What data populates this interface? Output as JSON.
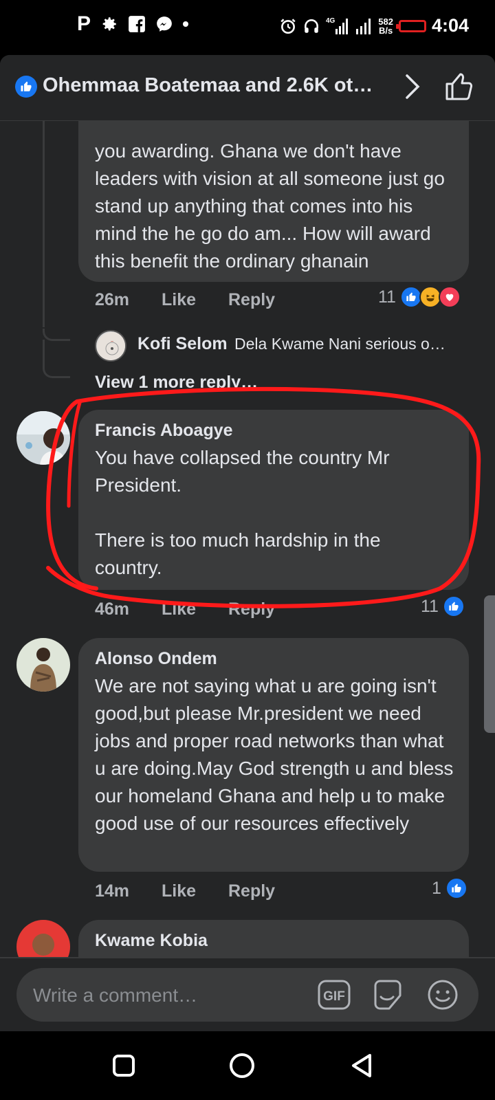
{
  "status_bar": {
    "time": "4:04",
    "net_speed_value": "582",
    "net_speed_unit": "B/s",
    "net_type": "4G",
    "left_icons": [
      "pinterest-icon",
      "settings-icon",
      "facebook-icon",
      "messenger-icon",
      "dot-icon"
    ],
    "right_icons": [
      "alarm-icon",
      "headphones-icon",
      "signal-icon",
      "signal-icon",
      "battery-icon"
    ]
  },
  "header": {
    "title": "Ohemmaa Boatemaa and 2.6K ot…"
  },
  "comments": [
    {
      "text": "you awarding. Ghana we don't have leaders with vision at all someone just go stand up anything that comes into his mind the he go do am... How will award this benefit the ordinary ghanain",
      "time": "26m",
      "like_label": "Like",
      "reply_label": "Reply",
      "reaction_count": "11",
      "reactions": [
        "like",
        "haha",
        "love"
      ]
    },
    {
      "name": "Francis Aboagye",
      "text_line1": "You have collapsed the country Mr President.",
      "text_line2": "There is too much hardship in the country.",
      "time": "46m",
      "like_label": "Like",
      "reply_label": "Reply",
      "reaction_count": "11",
      "reactions": [
        "like"
      ]
    },
    {
      "name": "Alonso Ondem",
      "text": "We are not saying what u are going isn't good,but please Mr.president we need jobs and proper road networks than what u are doing.May God strength u and bless our homeland Ghana and help u to make good use of our resources effectively",
      "time": "14m",
      "like_label": "Like",
      "reply_label": "Reply",
      "reaction_count": "1",
      "reactions": [
        "like"
      ]
    },
    {
      "name": "Kwame Kobia"
    }
  ],
  "reply_preview": {
    "name": "Kofi Selom",
    "text": "Dela Kwame Nani serious o…"
  },
  "view_more_replies": "View 1 more reply…",
  "composer": {
    "placeholder": "Write a comment…",
    "gif_label": "GIF"
  },
  "colors": {
    "background": "#242526",
    "bubble": "#3a3b3c",
    "like_blue": "#1877f2",
    "love_red": "#f33e58",
    "haha_yellow": "#f7b125",
    "annotation_red": "#ff1a1a"
  }
}
